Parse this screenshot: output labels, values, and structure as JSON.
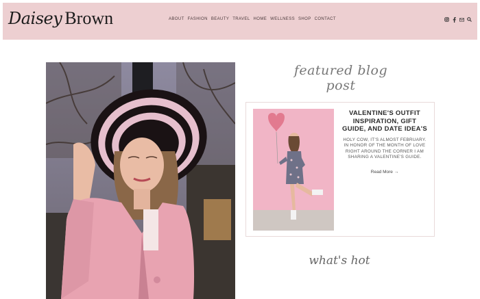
{
  "brand": {
    "logo_script": "Daisey",
    "logo_serif": "Brown"
  },
  "nav": {
    "items": [
      "ABOUT",
      "FASHION",
      "BEAUTY",
      "TRAVEL",
      "HOME",
      "WELLNESS",
      "SHOP",
      "CONTACT"
    ]
  },
  "social": {
    "icons": [
      "instagram-icon",
      "facebook-icon",
      "email-icon",
      "search-icon"
    ]
  },
  "featured": {
    "heading": "featured blog post",
    "post": {
      "title": "VALENTINE'S OUTFIT INSPIRATION, GIFT GUIDE, AND DATE IDEA'S",
      "excerpt": "HOLY COW, IT'S ALMOST FEBRUARY. IN HONOR OF THE MONTH OF LOVE RIGHT AROUND THE CORNER I AM SHARING A VALENTINE'S GUIDE.",
      "read_more": "Read More →"
    }
  },
  "hot": {
    "heading": "what's hot"
  },
  "colors": {
    "header_bg": "#edcfd1",
    "card_photo_bg": "#f1b5c6",
    "blazer": "#e8a3b1"
  }
}
